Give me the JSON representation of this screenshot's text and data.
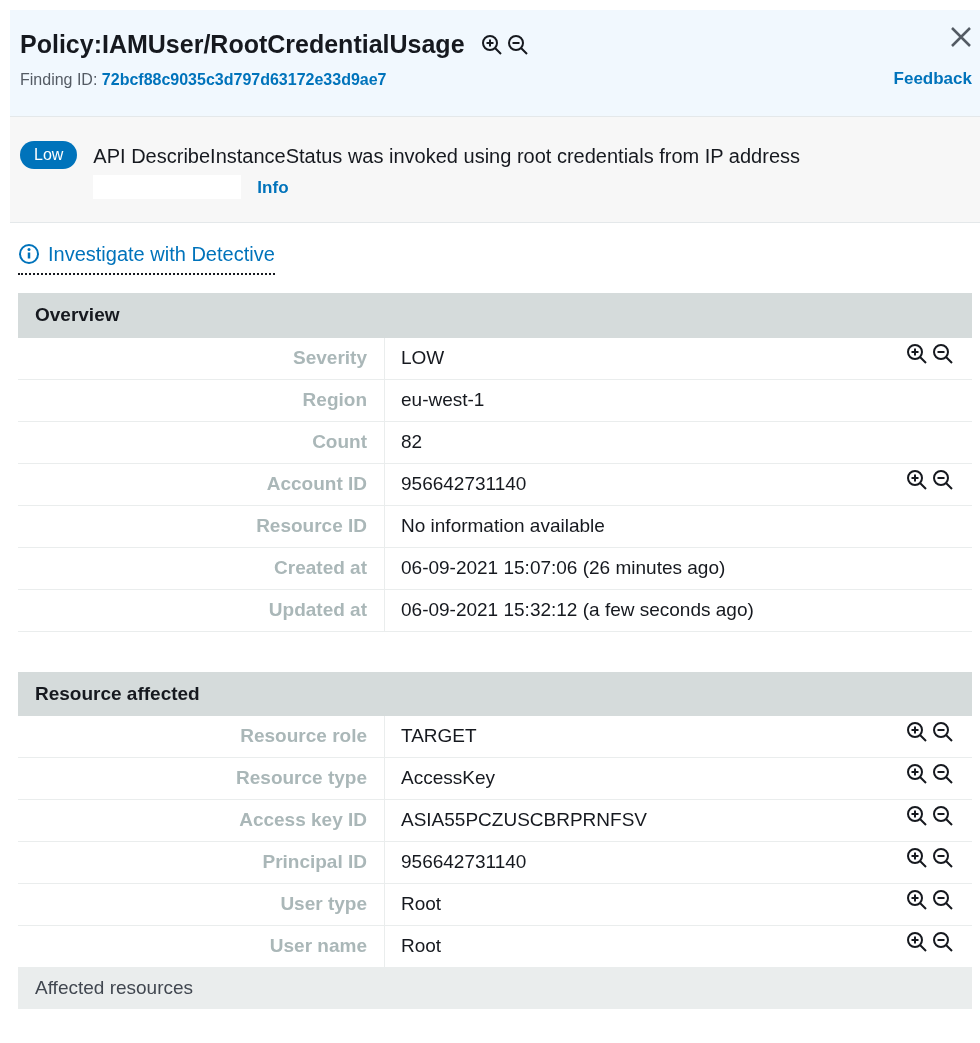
{
  "header": {
    "title": "Policy:IAMUser/RootCredentialUsage",
    "title_filter_icons": true,
    "finding_id_label": "Finding ID:",
    "finding_id": "72bcf88c9035c3d797d63172e33d9ae7",
    "feedback": "Feedback"
  },
  "banner": {
    "severity_badge": "Low",
    "message": "API DescribeInstanceStatus was invoked using root credentials from IP address",
    "info": "Info"
  },
  "detective_link": "Investigate with Detective",
  "sections": [
    {
      "title": "Overview",
      "rows": [
        {
          "label": "Severity",
          "value": "LOW",
          "filter_icons": true
        },
        {
          "label": "Region",
          "value": "eu-west-1",
          "filter_icons": false
        },
        {
          "label": "Count",
          "value": "82",
          "filter_icons": false
        },
        {
          "label": "Account ID",
          "value": "956642731140",
          "filter_icons": true
        },
        {
          "label": "Resource ID",
          "value": "No information available",
          "filter_icons": false
        },
        {
          "label": "Created at",
          "value": "06-09-2021 15:07:06 (26 minutes ago)",
          "filter_icons": false
        },
        {
          "label": "Updated at",
          "value": "06-09-2021 15:32:12 (a few seconds ago)",
          "filter_icons": false
        }
      ]
    },
    {
      "title": "Resource affected",
      "rows": [
        {
          "label": "Resource role",
          "value": "TARGET",
          "filter_icons": true
        },
        {
          "label": "Resource type",
          "value": "AccessKey",
          "filter_icons": true
        },
        {
          "label": "Access key ID",
          "value": "ASIA55PCZUSCBRPRNFSV",
          "filter_icons": true
        },
        {
          "label": "Principal ID",
          "value": "956642731140",
          "filter_icons": true
        },
        {
          "label": "User type",
          "value": "Root",
          "filter_icons": true
        },
        {
          "label": "User name",
          "value": "Root",
          "filter_icons": true
        }
      ]
    }
  ],
  "subsection": "Affected resources"
}
